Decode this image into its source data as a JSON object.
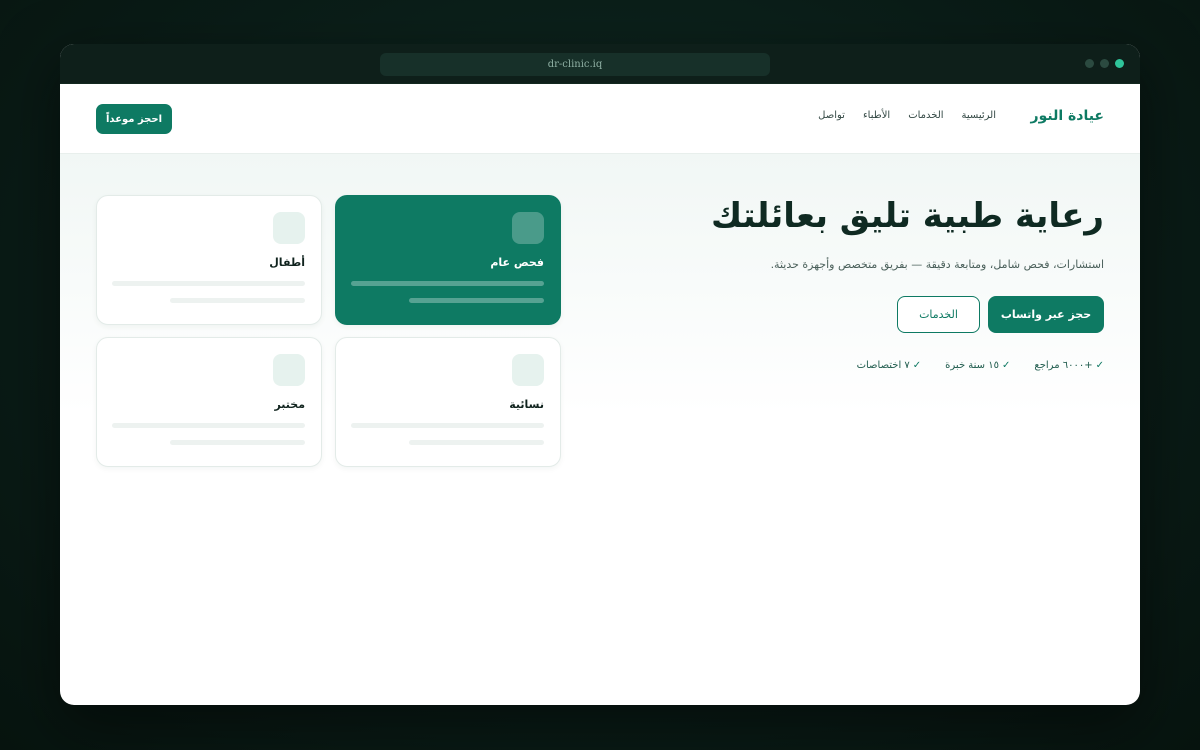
{
  "browser": {
    "url": "dr-clinic.iq"
  },
  "nav": {
    "brand": "عيادة النور",
    "links": [
      "الرئيسية",
      "الخدمات",
      "الأطباء",
      "تواصل"
    ],
    "book_button": "احجز موعداً"
  },
  "hero": {
    "title": "رعاية طبية تليق بعائلتك",
    "subtitle": "استشارات، فحص شامل، ومتابعة دقيقة — بفريق متخصص وأجهزة حديثة.",
    "cta_primary": "حجز عبر واتساب",
    "cta_secondary": "الخدمات",
    "stats": [
      "+٦٠٠٠ مراجع",
      "١٥ سنة خبرة",
      "٧ اختصاصات"
    ],
    "check_glyph": "✓"
  },
  "services": [
    {
      "name": "فحص عام",
      "featured": true
    },
    {
      "name": "أطفال",
      "featured": false
    },
    {
      "name": "نسائية",
      "featured": false
    },
    {
      "name": "مختبر",
      "featured": false
    }
  ],
  "colors": {
    "brand": "#0e7a63",
    "dark": "#0f2a22",
    "active_dot": "#2fc49a"
  }
}
